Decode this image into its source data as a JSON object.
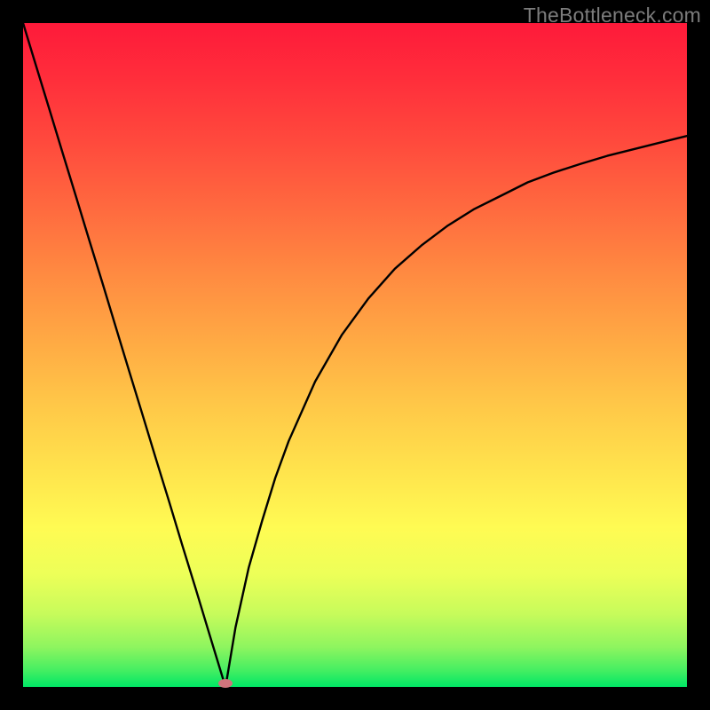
{
  "watermark": "TheBottleneck.com",
  "chart_data": {
    "type": "line",
    "title": "",
    "xlabel": "",
    "ylabel": "",
    "xlim": [
      0,
      100
    ],
    "ylim": [
      0,
      100
    ],
    "x": [
      0,
      2,
      4,
      6,
      8,
      10,
      12,
      14,
      16,
      18,
      20,
      22,
      24,
      26,
      28,
      30,
      30.5,
      31,
      32,
      34,
      36,
      38,
      40,
      44,
      48,
      52,
      56,
      60,
      64,
      68,
      72,
      76,
      80,
      84,
      88,
      92,
      96,
      100
    ],
    "values": [
      100,
      93.4,
      86.9,
      80.3,
      73.8,
      67.2,
      60.7,
      54.1,
      47.5,
      41.0,
      34.4,
      27.9,
      21.3,
      14.8,
      8.2,
      1.6,
      0.0,
      3.0,
      9.0,
      18.0,
      25.0,
      31.5,
      37.0,
      46.0,
      53.0,
      58.5,
      63.0,
      66.5,
      69.5,
      72.0,
      74.0,
      76.0,
      77.5,
      78.8,
      80.0,
      81.0,
      82.0,
      83.0
    ],
    "minimum_point": {
      "x": 30.5,
      "y": 0.0
    },
    "note": "Curve minimum highlighted by a small pink blob at x≈30.5 near y=0"
  },
  "colors": {
    "top_red": "#fe1a3a",
    "bottom_green": "#00e765",
    "curve": "#000000",
    "border": "#000000",
    "marker": "#d0747c"
  }
}
